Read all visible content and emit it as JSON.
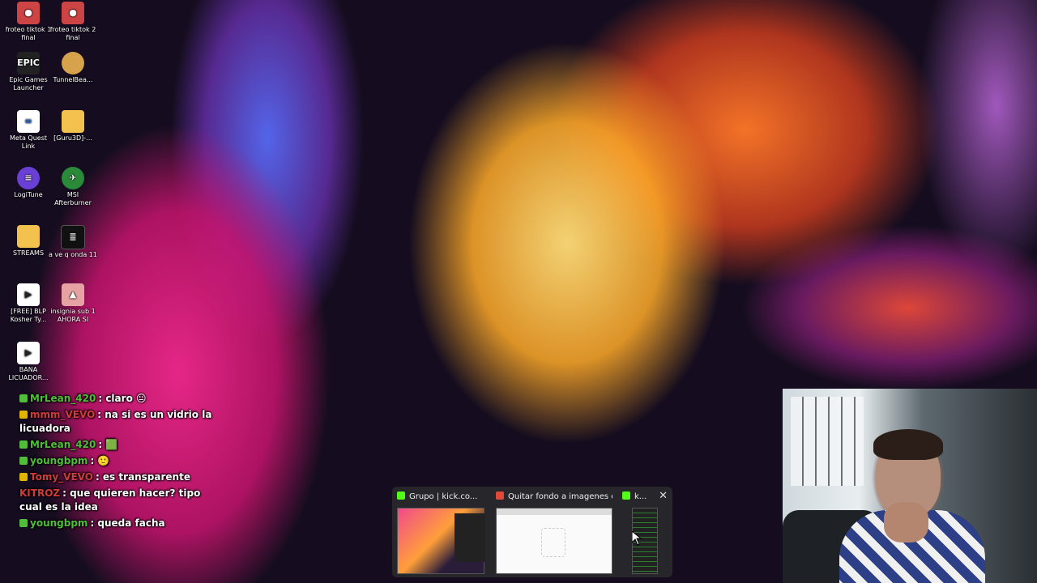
{
  "desktop": {
    "icons": [
      {
        "label": "froteo tiktok 1 final",
        "icon": "video-project-icon"
      },
      {
        "label": "froteo tiktok 2 final",
        "icon": "video-project-icon"
      },
      {
        "label": "Epic Games Launcher",
        "icon": "epic-games-icon",
        "glyph": "EPIC"
      },
      {
        "label": "TunnelBea...",
        "icon": "tunnelbear-icon"
      },
      {
        "label": "Meta Quest Link",
        "icon": "meta-icon",
        "glyph": "∞"
      },
      {
        "label": "[Guru3D]-...",
        "icon": "folder-icon"
      },
      {
        "label": "LogiTune",
        "icon": "logitune-icon",
        "glyph": "≡"
      },
      {
        "label": "MSI Afterburner",
        "icon": "msi-afterburner-icon",
        "glyph": "✈"
      },
      {
        "label": "STREAMS",
        "icon": "folder-icon"
      },
      {
        "label": "a ve q onda 11",
        "icon": "document-icon"
      },
      {
        "label": "[FREE] BLP Kosher Ty...",
        "icon": "media-file-icon",
        "glyph": "▶"
      },
      {
        "label": "insignia sub 1 AHORA SI",
        "icon": "image-file-icon"
      },
      {
        "label": "BANA LICUADOR...",
        "icon": "media-file-icon",
        "glyph": "▶"
      }
    ]
  },
  "chat": {
    "messages": [
      {
        "user": "MrLean_420",
        "text": ": claro 😐",
        "color": "#4fbf3a"
      },
      {
        "user": "mmm_VEVO",
        "text": ": na si es un vidrio la licuadora",
        "color": "#d23b3b"
      },
      {
        "user": "MrLean_420",
        "text": ": 🟩",
        "color": "#4fbf3a"
      },
      {
        "user": "youngbpm",
        "text": ": 🙂",
        "color": "#4fbf3a"
      },
      {
        "user": "Tomy_VEVO",
        "text": ": es transparente",
        "color": "#d23b3b"
      },
      {
        "user": "KITROZ",
        "text": ": que quieren hacer? tipo cual es la idea",
        "color": "#d23b3b"
      },
      {
        "user": "youngbpm",
        "text": ": queda facha",
        "color": "#4fbf3a"
      }
    ]
  },
  "taskbar_preview": {
    "items": [
      {
        "title": "Grupo | kick.co...",
        "app_color": "#53fc18"
      },
      {
        "title": "Quitar fondo a imagenes o...",
        "app_color": "#e0483a"
      },
      {
        "title": "k...",
        "app_color": "#53fc18"
      }
    ],
    "close_glyph": "✕"
  },
  "colors": {
    "kick_green": "#53fc18",
    "brave_red": "#e0483a"
  }
}
